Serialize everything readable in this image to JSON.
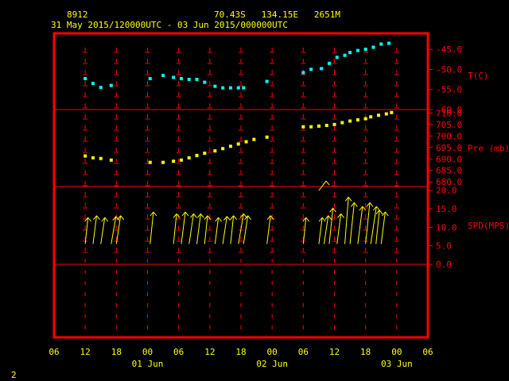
{
  "header": {
    "station_id": "8912",
    "location": "70.43S   134.15E   2651M",
    "time_range": "31 May 2015/120000UTC - 03 Jun 2015/000000UTC"
  },
  "footer": {
    "page_number": "2"
  },
  "colors": {
    "background": "#000000",
    "frame": "#ff0000",
    "text": "#ffff00",
    "axis_labels": "#ff0000",
    "temperature": "#00ffff",
    "pressure": "#ffff00",
    "wind": "#ffff00"
  },
  "chart_data": {
    "type": "scatter",
    "x_axis": {
      "unit": "hours since 31 May 06Z",
      "range": [
        0,
        72
      ],
      "tick_labels": [
        "06",
        "12",
        "18",
        "00",
        "06",
        "12",
        "18",
        "00",
        "06",
        "12",
        "18",
        "00",
        "06"
      ],
      "tick_hours": [
        0,
        6,
        12,
        18,
        24,
        30,
        36,
        42,
        48,
        54,
        60,
        66,
        72
      ],
      "date_labels": [
        {
          "text": "01 Jun",
          "hour": 18
        },
        {
          "text": "02 Jun",
          "hour": 42
        },
        {
          "text": "03 Jun",
          "hour": 66
        }
      ]
    },
    "panels": [
      {
        "key": "temperature",
        "label": "T(C)",
        "ticks": [
          "-45.0",
          "-50.0",
          "-55.0",
          "-60.0"
        ],
        "tick_values": [
          -45,
          -50,
          -55,
          -60
        ],
        "ylim": [
          -60,
          -43
        ],
        "series": [
          {
            "values": [
              [
                6,
                -52.3
              ],
              [
                7.5,
                -53.5
              ],
              [
                9,
                -54.5
              ],
              [
                11,
                -54
              ],
              [
                18.5,
                -52.3
              ],
              [
                21,
                -51.5
              ],
              [
                23,
                -52
              ],
              [
                24.5,
                -52.3
              ],
              [
                26,
                -52.5
              ],
              [
                27.5,
                -52.5
              ],
              [
                29,
                -53.2
              ],
              [
                31,
                -54.2
              ],
              [
                32.5,
                -54.6
              ],
              [
                34,
                -54.6
              ],
              [
                35.5,
                -54.6
              ],
              [
                36.5,
                -54.6
              ],
              [
                41,
                -53
              ],
              [
                48,
                -50.8
              ],
              [
                49.5,
                -50
              ],
              [
                51.5,
                -49.8
              ],
              [
                53,
                -48.5
              ],
              [
                54.5,
                -47
              ],
              [
                56,
                -46.5
              ],
              [
                57,
                -45.8
              ],
              [
                58.5,
                -45.3
              ],
              [
                60,
                -45
              ],
              [
                61.5,
                -44.5
              ],
              [
                63,
                -43.7
              ],
              [
                64.5,
                -43.5
              ]
            ]
          }
        ]
      },
      {
        "key": "pressure",
        "label": "Pre (mb)",
        "ticks": [
          "710.0",
          "705.0",
          "700.0",
          "695.0",
          "690.0",
          "685.0",
          "680.0"
        ],
        "tick_values": [
          710,
          705,
          700,
          695,
          690,
          685,
          680
        ],
        "ylim": [
          678,
          711.5
        ],
        "series": [
          {
            "values": [
              [
                6,
                691.3
              ],
              [
                7.5,
                690.5
              ],
              [
                9,
                690.2
              ],
              [
                11,
                689.5
              ],
              [
                18.5,
                688.5
              ],
              [
                21,
                688.5
              ],
              [
                23,
                689
              ],
              [
                24.5,
                689.5
              ],
              [
                26,
                690.5
              ],
              [
                27.5,
                691.5
              ],
              [
                29,
                692.5
              ],
              [
                31,
                693.5
              ],
              [
                32.5,
                694.5
              ],
              [
                34,
                695.5
              ],
              [
                35.5,
                696.5
              ],
              [
                37,
                697.5
              ],
              [
                38.5,
                698.5
              ],
              [
                41,
                699.5
              ],
              [
                48,
                704
              ],
              [
                49.5,
                704
              ],
              [
                51,
                704.3
              ],
              [
                52.5,
                704.6
              ],
              [
                54,
                705
              ],
              [
                55.5,
                705.8
              ],
              [
                57,
                706.5
              ],
              [
                58.5,
                707
              ],
              [
                60,
                707.5
              ],
              [
                61,
                708.3
              ],
              [
                62.5,
                709
              ],
              [
                64,
                709.6
              ],
              [
                65,
                710.2
              ]
            ]
          }
        ]
      },
      {
        "key": "wind",
        "label": "SPD(MPS)",
        "ticks": [
          "20.0",
          "15.0",
          "10.0",
          "5.0",
          "0.0"
        ],
        "tick_values": [
          20,
          15,
          10,
          5,
          0
        ],
        "ylim": [
          0,
          21
        ],
        "vectors": [
          {
            "hour": 6,
            "speed": 10.5,
            "dir": 200
          },
          {
            "hour": 7.5,
            "speed": 11,
            "dir": 205
          },
          {
            "hour": 9,
            "speed": 10.5,
            "dir": 210
          },
          {
            "hour": 11,
            "speed": 10.8,
            "dir": 215
          },
          {
            "hour": 12,
            "speed": 11,
            "dir": 210
          },
          {
            "hour": 18.5,
            "speed": 12,
            "dir": 200
          },
          {
            "hour": 23,
            "speed": 11.5,
            "dir": 200
          },
          {
            "hour": 24.5,
            "speed": 12,
            "dir": 205
          },
          {
            "hour": 26,
            "speed": 11.5,
            "dir": 210
          },
          {
            "hour": 27.5,
            "speed": 11.5,
            "dir": 205
          },
          {
            "hour": 29,
            "speed": 11,
            "dir": 200
          },
          {
            "hour": 31,
            "speed": 10.5,
            "dir": 205
          },
          {
            "hour": 32.5,
            "speed": 10.8,
            "dir": 210
          },
          {
            "hour": 34,
            "speed": 11,
            "dir": 200
          },
          {
            "hour": 35.5,
            "speed": 11.5,
            "dir": 215
          },
          {
            "hour": 36.5,
            "speed": 11,
            "dir": 210
          },
          {
            "hour": 41,
            "speed": 11,
            "dir": 205
          },
          {
            "hour": 48,
            "speed": 10.5,
            "dir": 200
          },
          {
            "hour": 51,
            "speed": 10.5,
            "dir": 205
          },
          {
            "hour": 52,
            "speed": 11,
            "dir": 210
          },
          {
            "hour": 53,
            "speed": 13,
            "dir": 200
          },
          {
            "hour": 54.5,
            "speed": 11.5,
            "dir": 205
          },
          {
            "hour": 56,
            "speed": 16,
            "dir": 195
          },
          {
            "hour": 57,
            "speed": 14.5,
            "dir": 200
          },
          {
            "hour": 58.5,
            "speed": 13.5,
            "dir": 205
          },
          {
            "hour": 60,
            "speed": 14.5,
            "dir": 200
          },
          {
            "hour": 61,
            "speed": 13.5,
            "dir": 210
          },
          {
            "hour": 62,
            "speed": 12.5,
            "dir": 200
          },
          {
            "hour": 63,
            "speed": 12,
            "dir": 205
          },
          {
            "hour": 51,
            "speed": 22.5,
            "dir": 200
          }
        ]
      }
    ]
  }
}
